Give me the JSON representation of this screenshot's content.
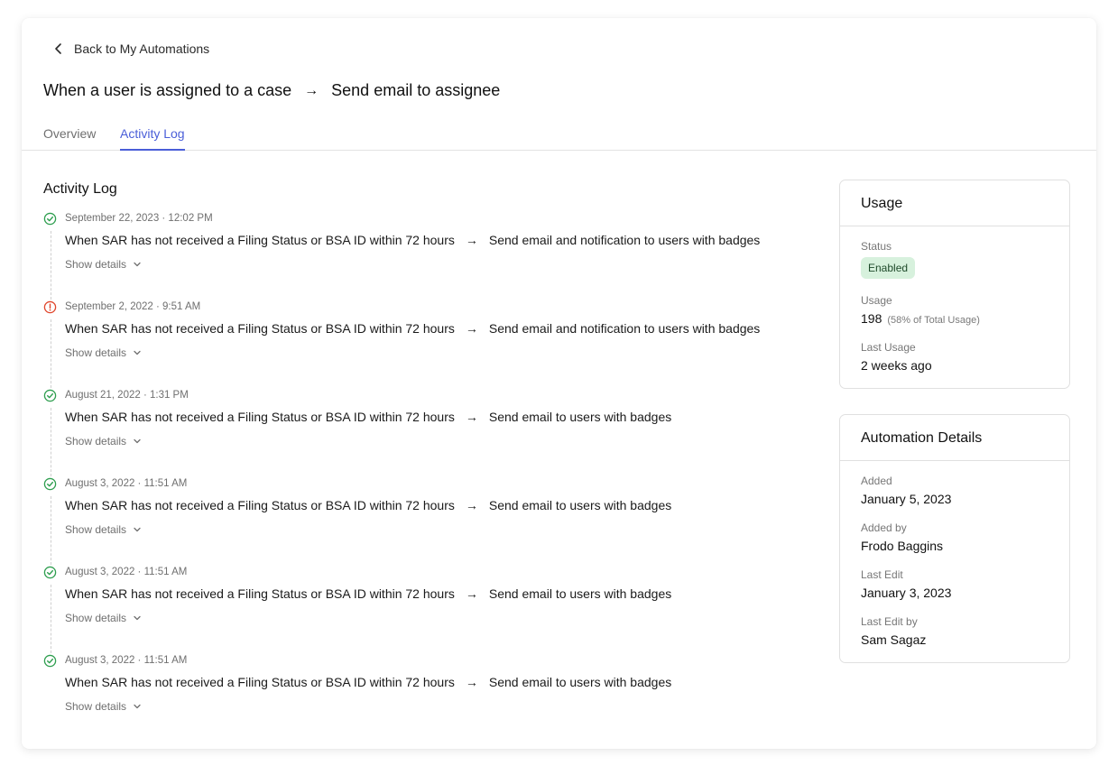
{
  "nav": {
    "back_label": "Back to My Automations",
    "back_icon": "chevron-left-icon"
  },
  "title": {
    "trigger": "When a user is assigned to a case",
    "arrow": "→",
    "action": "Send email to assignee"
  },
  "tabs": [
    {
      "label": "Overview",
      "active": false
    },
    {
      "label": "Activity Log",
      "active": true
    }
  ],
  "activity": {
    "title": "Activity Log",
    "show_details_label": "Show details",
    "entries": [
      {
        "status": "success",
        "timestamp": "September 22, 2023 · 12:02 PM",
        "trigger": "When SAR has not received a Filing Status or BSA ID within 72 hours",
        "arrow": "→",
        "action": "Send email and notification to users with badges"
      },
      {
        "status": "error",
        "timestamp": "September 2, 2022 · 9:51 AM",
        "trigger": "When SAR has not received a Filing Status or BSA ID within 72 hours",
        "arrow": "→",
        "action": "Send email and notification to users with badges"
      },
      {
        "status": "success",
        "timestamp": "August 21, 2022 · 1:31 PM",
        "trigger": "When SAR has not received a Filing Status or BSA ID within 72 hours",
        "arrow": "→",
        "action": "Send email to users with badges"
      },
      {
        "status": "success",
        "timestamp": "August 3, 2022 · 11:51 AM",
        "trigger": "When SAR has not received a Filing Status or BSA ID within 72 hours",
        "arrow": "→",
        "action": "Send email to users with badges"
      },
      {
        "status": "success",
        "timestamp": "August 3, 2022 · 11:51 AM",
        "trigger": "When SAR has not received a Filing Status or BSA ID within 72 hours",
        "arrow": "→",
        "action": "Send email to users with badges"
      },
      {
        "status": "success",
        "timestamp": "August 3, 2022 · 11:51 AM",
        "trigger": "When SAR has not received a Filing Status or BSA ID within 72 hours",
        "arrow": "→",
        "action": "Send email to users with badges"
      }
    ]
  },
  "usage_panel": {
    "title": "Usage",
    "status_label": "Status",
    "status_value": "Enabled",
    "usage_label": "Usage",
    "usage_count": "198",
    "usage_pct": "(58% of Total Usage)",
    "last_usage_label": "Last Usage",
    "last_usage_value": "2 weeks ago"
  },
  "details_panel": {
    "title": "Automation Details",
    "added_label": "Added",
    "added_value": "January 5, 2023",
    "added_by_label": "Added by",
    "added_by_value": "Frodo Baggins",
    "last_edit_label": "Last Edit",
    "last_edit_value": "January 3, 2023",
    "last_edit_by_label": "Last Edit by",
    "last_edit_by_value": "Sam Sagaz"
  },
  "colors": {
    "accent": "#4a5ed8",
    "success": "#2e9e4f",
    "error": "#e0452b",
    "badge_bg": "#d7f1dd"
  }
}
